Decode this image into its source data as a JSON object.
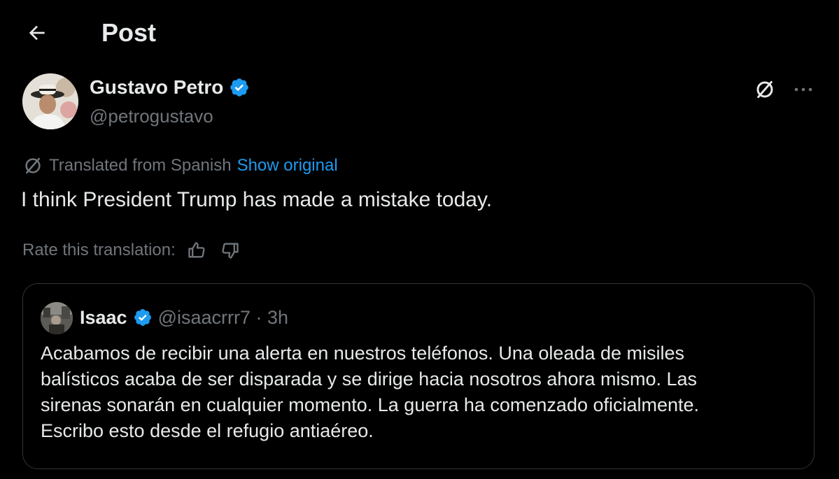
{
  "header": {
    "title": "Post",
    "back_icon": "arrow-left-icon"
  },
  "author": {
    "name": "Gustavo Petro",
    "handle": "@petrogustavo",
    "verified": true,
    "verified_color": "#1d9bf0"
  },
  "translation": {
    "label": "Translated from Spanish",
    "show_original": "Show original",
    "link_color": "#1d9bf0"
  },
  "tweet": {
    "text": "I think President Trump has made a mistake today."
  },
  "rating": {
    "label": "Rate this translation:",
    "like_icon": "thumbs-up-icon",
    "dislike_icon": "thumbs-down-icon"
  },
  "quote": {
    "name": "Isaac",
    "verified": true,
    "handle_time": "@isaacrrr7 · 3h",
    "lines": [
      "Acabamos de recibir una alerta en nuestros teléfonos. Una oleada de misiles",
      "balísticos acaba de ser disparada y se dirige hacia nosotros ahora mismo. Las",
      "sirenas sonarán en cualquier momento. La guerra ha comenzado oficialmente.",
      "Escribo esto desde el refugio antiaéreo."
    ]
  },
  "colors": {
    "background": "#000000",
    "text_primary": "#e7e9ea",
    "text_secondary": "#71767b",
    "border": "#2f3336"
  }
}
